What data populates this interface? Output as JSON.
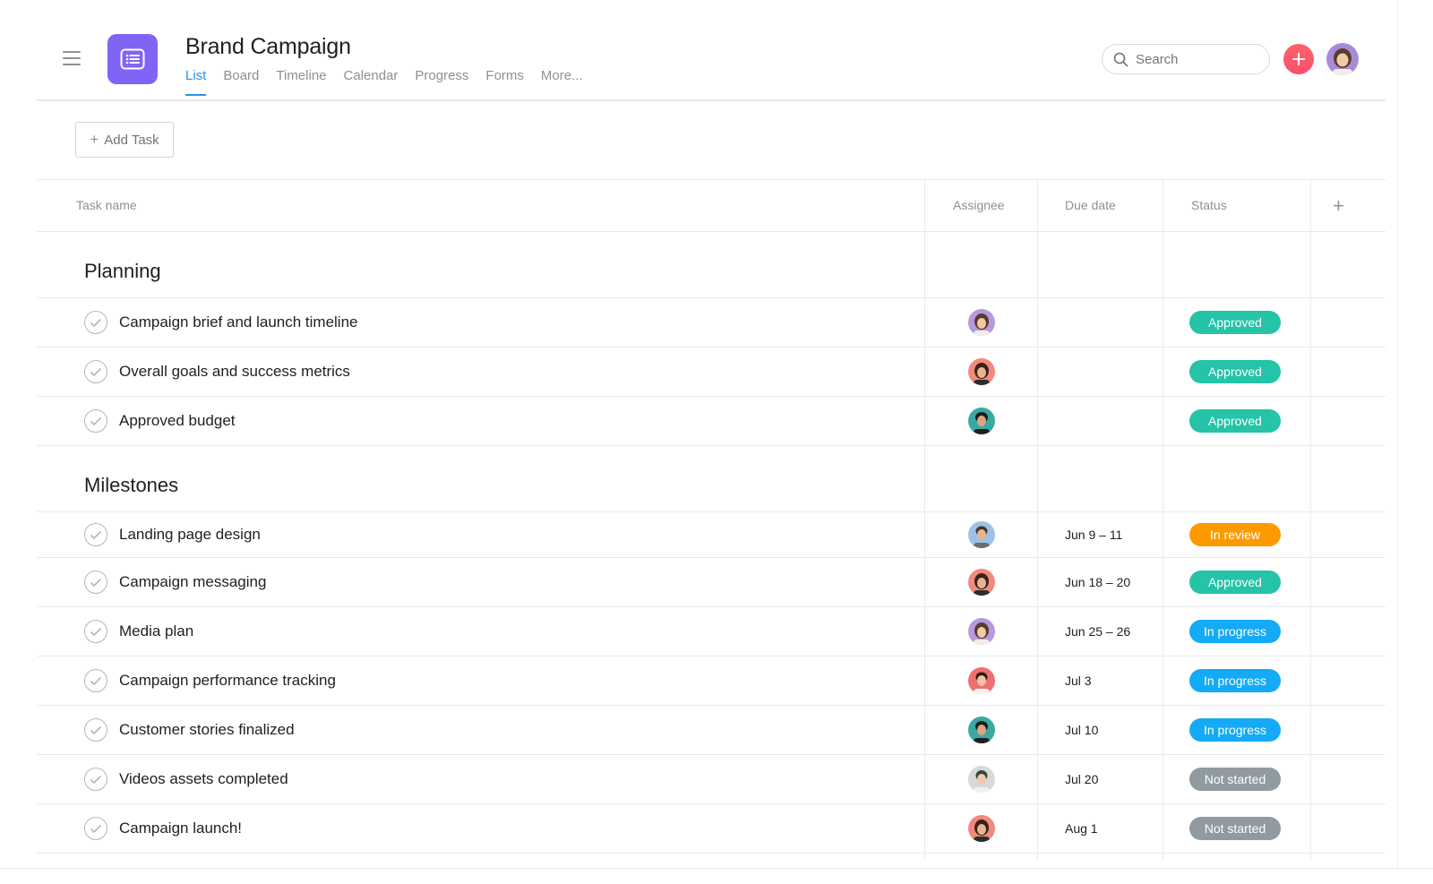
{
  "header": {
    "menu_icon": "hamburger-menu-icon",
    "project_icon": "list-icon",
    "project_color": "#7f64f5",
    "title": "Brand Campaign",
    "tabs": [
      {
        "label": "List",
        "active": true
      },
      {
        "label": "Board",
        "active": false
      },
      {
        "label": "Timeline",
        "active": false
      },
      {
        "label": "Calendar",
        "active": false
      },
      {
        "label": "Progress",
        "active": false
      },
      {
        "label": "Forms",
        "active": false
      },
      {
        "label": "More...",
        "active": false
      }
    ],
    "search": {
      "placeholder": "Search",
      "icon": "search-icon"
    },
    "add_button_icon": "plus-icon",
    "accent_color": "#1e98e4"
  },
  "toolbar": {
    "add_task_label": "Add Task"
  },
  "table": {
    "columns": [
      "Task name",
      "Assignee",
      "Due date",
      "Status"
    ],
    "add_column_icon": "plus-icon",
    "sections": [
      {
        "title": "Planning",
        "tasks": [
          {
            "name": "Campaign brief and launch timeline",
            "assignee": "avatar-woman-purple",
            "due": "",
            "status": "Approved"
          },
          {
            "name": "Overall goals and success metrics",
            "assignee": "avatar-woman-red",
            "due": "",
            "status": "Approved"
          },
          {
            "name": "Approved budget",
            "assignee": "avatar-man-teal",
            "due": "",
            "status": "Approved"
          }
        ]
      },
      {
        "title": "Milestones",
        "tasks": [
          {
            "name": "Landing page design",
            "assignee": "avatar-man-blue",
            "due": "Jun 9 – 11",
            "status": "In review"
          },
          {
            "name": "Campaign messaging",
            "assignee": "avatar-woman-red",
            "due": "Jun 18 – 20",
            "status": "Approved"
          },
          {
            "name": "Media plan",
            "assignee": "avatar-woman-purple",
            "due": "Jun 25 – 26",
            "status": "In progress"
          },
          {
            "name": "Campaign performance tracking",
            "assignee": "avatar-man-red",
            "due": "Jul 3",
            "status": "In progress"
          },
          {
            "name": "Customer stories finalized",
            "assignee": "avatar-man-teal",
            "due": "Jul 10",
            "status": "In progress"
          },
          {
            "name": "Videos assets completed",
            "assignee": "avatar-woman-gray",
            "due": "Jul 20",
            "status": "Not started"
          },
          {
            "name": "Campaign launch!",
            "assignee": "avatar-woman-red",
            "due": "Aug 1",
            "status": "Not started"
          }
        ]
      }
    ]
  },
  "status_colors": {
    "Approved": "#25c3a7",
    "In review": "#fd9a00",
    "In progress": "#14aaf5",
    "Not started": "#8f9ba0"
  }
}
